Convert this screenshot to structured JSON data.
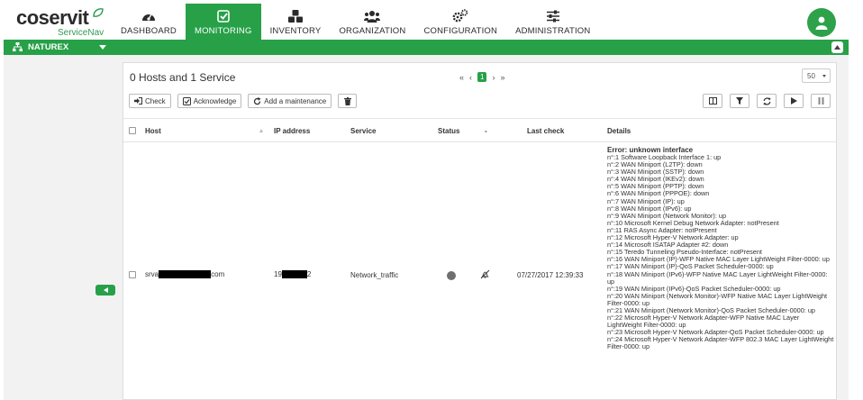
{
  "app": {
    "logo_main": "coservit",
    "logo_sub": "ServiceNav"
  },
  "nav": {
    "items": [
      {
        "label": "DASHBOARD",
        "icon": "dashboard-gauge-icon"
      },
      {
        "label": "MONITORING",
        "icon": "checkbox-icon",
        "active": true
      },
      {
        "label": "INVENTORY",
        "icon": "cubes-icon"
      },
      {
        "label": "ORGANIZATION",
        "icon": "users-icon"
      },
      {
        "label": "CONFIGURATION",
        "icon": "cogs-icon"
      },
      {
        "label": "ADMINISTRATION",
        "icon": "sliders-icon"
      }
    ]
  },
  "site_selector": {
    "value": "NATUREX"
  },
  "panel": {
    "title": "0 Hosts and 1 Service",
    "pager": {
      "first": "«",
      "prev": "‹",
      "current": "1",
      "next": "›",
      "last": "»"
    },
    "per_page": "50"
  },
  "actions": {
    "check": "Check",
    "acknowledge": "Acknowledge",
    "add_maintenance": "Add a maintenance"
  },
  "table": {
    "headers": {
      "host": "Host",
      "ip": "IP address",
      "service": "Service",
      "status": "Status",
      "dash": "-",
      "last_check": "Last check",
      "details": "Details"
    },
    "row": {
      "host_prefix": "srva",
      "host_suffix": "com",
      "ip_prefix": "19",
      "ip_suffix": "2",
      "service": "Network_traffic",
      "last_check": "07/27/2017 12:39:33",
      "details_title": "Error: unknown interface",
      "details_lines": [
        "n°:1 Software Loopback Interface 1: up",
        "n°:2 WAN Miniport (L2TP): down",
        "n°:3 WAN Miniport (SSTP): down",
        "n°:4 WAN Miniport (IKEv2): down",
        "n°:5 WAN Miniport (PPTP): down",
        "n°:6 WAN Miniport (PPPOE): down",
        "n°:7 WAN Miniport (IP): up",
        "n°:8 WAN Miniport (IPv6): up",
        "n°:9 WAN Miniport (Network Monitor): up",
        "n°:10 Microsoft Kernel Debug Network Adapter: notPresent",
        "n°:11 RAS Async Adapter: notPresent",
        "n°:12 Microsoft Hyper-V Network Adapter: up",
        "n°:14 Microsoft ISATAP Adapter #2: down",
        "n°:15 Teredo Tunneling Pseudo-Interface: notPresent",
        "n°:16 WAN Miniport (IP)-WFP Native MAC Layer LightWeight Filter-0000: up",
        "n°:17 WAN Miniport (IP)-QoS Packet Scheduler-0000: up",
        "n°:18 WAN Miniport (IPv6)-WFP Native MAC Layer LightWeight Filter-0000: up",
        "n°:19 WAN Miniport (IPv6)-QoS Packet Scheduler-0000: up",
        "n°:20 WAN Miniport (Network Monitor)-WFP Native MAC Layer LightWeight Filter-0000: up",
        "n°:21 WAN Miniport (Network Monitor)-QoS Packet Scheduler-0000: up",
        "n°:22 Microsoft Hyper-V Network Adapter-WFP Native MAC Layer LightWeight Filter-0000: up",
        "n°:23 Microsoft Hyper-V Network Adapter-QoS Packet Scheduler-0000: up",
        "n°:24 Microsoft Hyper-V Network Adapter-WFP 802.3 MAC Layer LightWeight Filter-0000: up"
      ]
    }
  },
  "colors": {
    "brand_green": "#27a048",
    "status_unknown": "#6f6f6f",
    "redaction": "#000000"
  }
}
